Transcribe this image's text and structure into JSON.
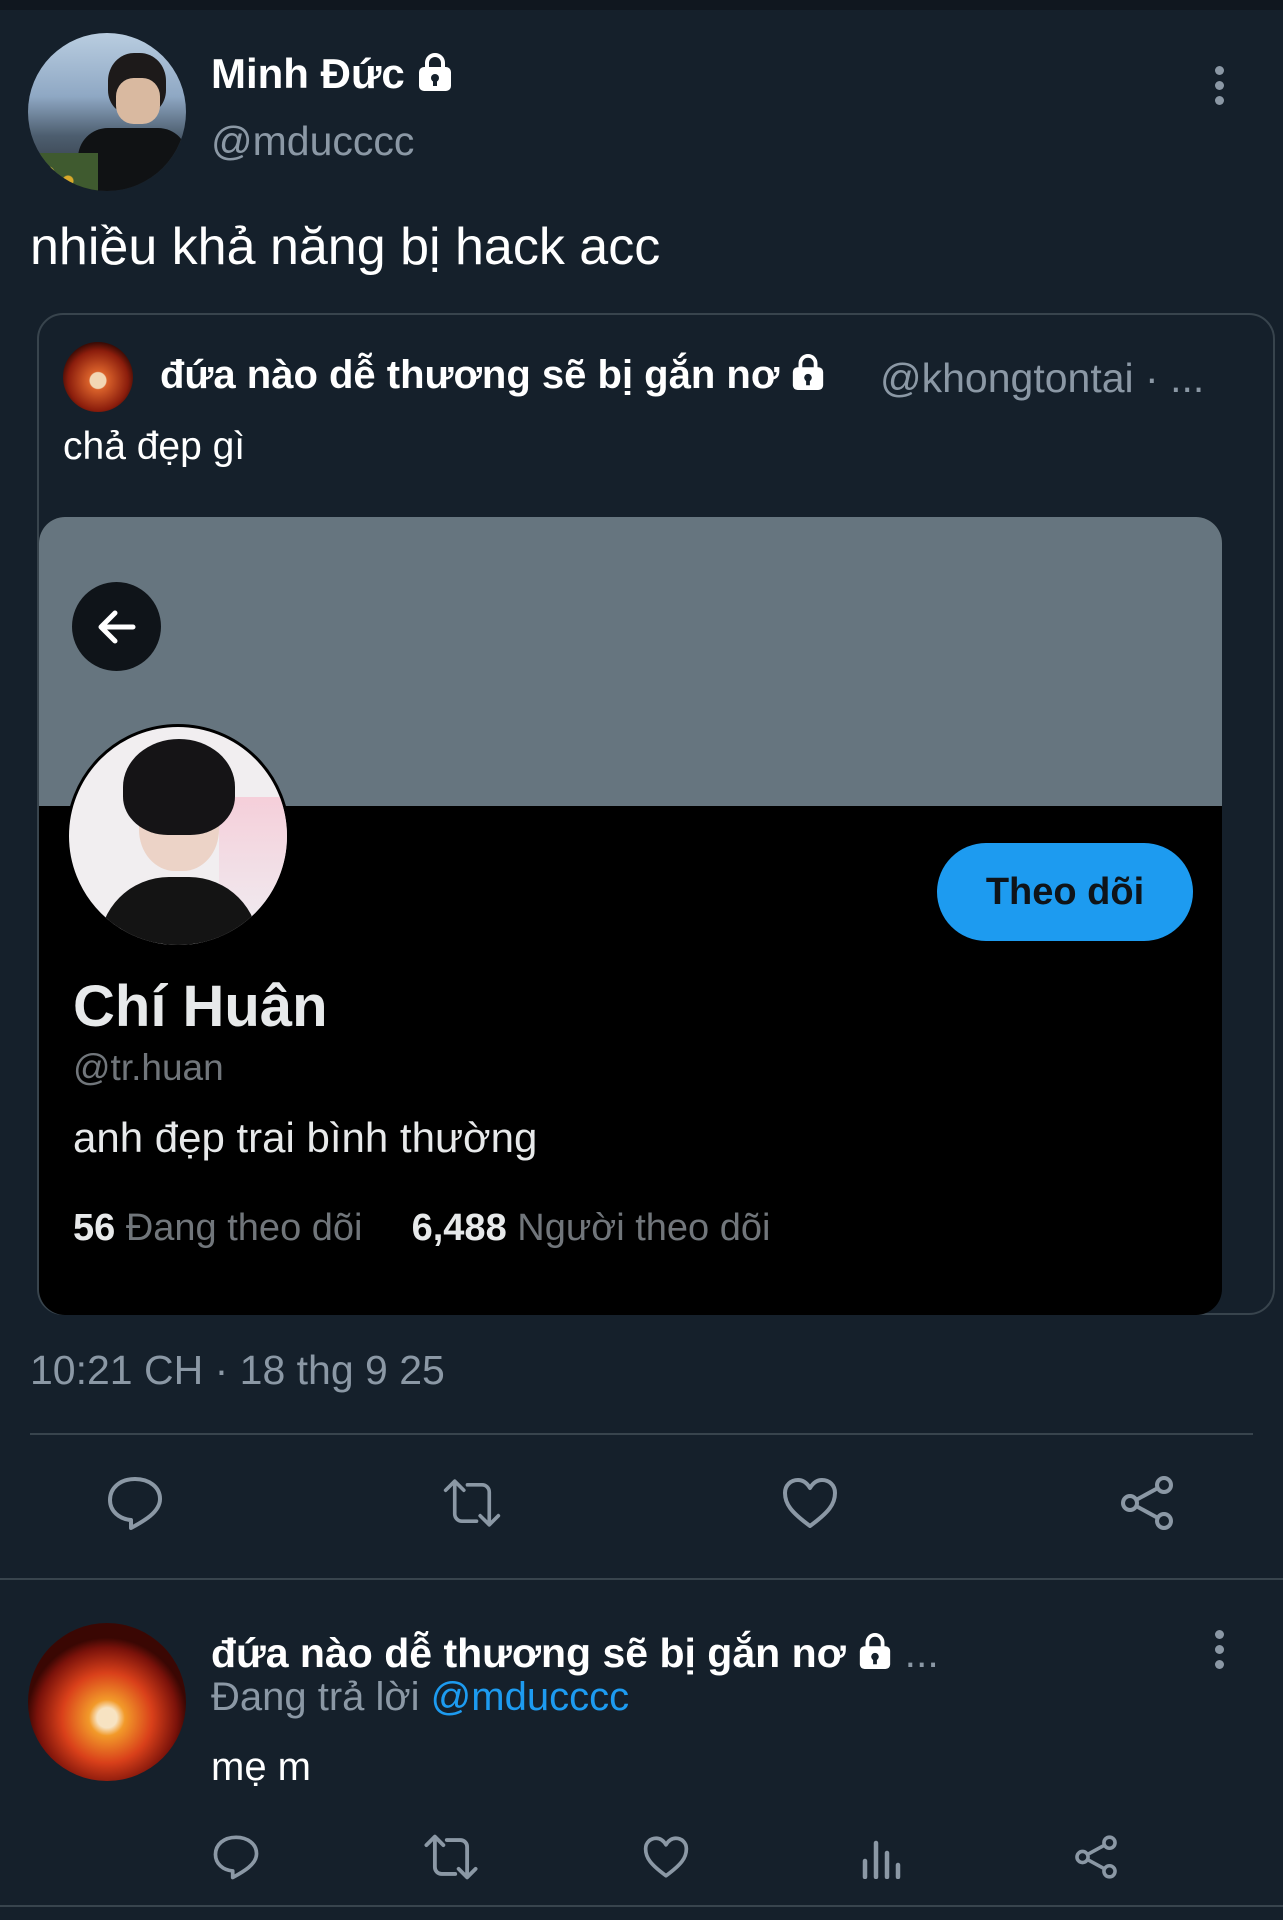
{
  "tweet": {
    "author_name": "Minh Đức",
    "author_handle": "@mducccc",
    "text": "nhiều khả năng bị hack acc",
    "timestamp": "10:21 CH · 18 thg 9 25"
  },
  "quote": {
    "author_name": "đứa nào dễ thương sẽ bị gắn nơ",
    "author_handle": "@khongtontai · ...",
    "text": "chả đẹp gì",
    "profile_card": {
      "name": "Chí Huân",
      "handle": "@tr.huan",
      "bio": "anh đẹp trai bình thường",
      "following_count": "56",
      "following_label": "Đang theo dõi",
      "followers_count": "6,488",
      "followers_label": "Người theo dõi",
      "follow_button": "Theo dõi"
    }
  },
  "reply": {
    "author_name": "đứa nào dễ thương sẽ bị gắn nơ",
    "ellipsis": "...",
    "replying_to_label": "Đang trả lời",
    "replying_to_handle": "@mducccc",
    "text": "mẹ m"
  },
  "colors": {
    "background": "#15202b",
    "accent": "#1d9bf0",
    "muted": "#8b98a5",
    "border": "#38444d"
  },
  "icons": [
    "lock-icon",
    "more-icon",
    "back-arrow-icon",
    "reply-icon",
    "retweet-icon",
    "like-icon",
    "share-icon",
    "views-icon"
  ]
}
